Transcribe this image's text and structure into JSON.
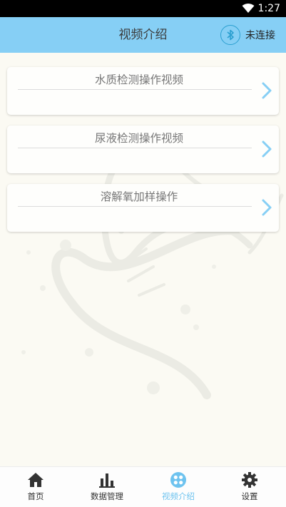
{
  "status_bar": {
    "time": "1:27"
  },
  "header": {
    "title": "视频介绍",
    "bluetooth_status": "未连接"
  },
  "videos": [
    {
      "label": "水质检测操作视频"
    },
    {
      "label": "尿液检测操作视频"
    },
    {
      "label": "溶解氧加样操作"
    }
  ],
  "bottom_nav": {
    "items": [
      {
        "label": "首页",
        "icon": "home-icon"
      },
      {
        "label": "数据管理",
        "icon": "bar-chart-icon"
      },
      {
        "label": "视频介绍",
        "icon": "video-grid-icon"
      },
      {
        "label": "设置",
        "icon": "gear-icon"
      }
    ],
    "active_index": 2
  },
  "colors": {
    "header_bg": "#86cff5",
    "accent": "#6ec3ef",
    "page_bg": "#fbfaf3"
  }
}
